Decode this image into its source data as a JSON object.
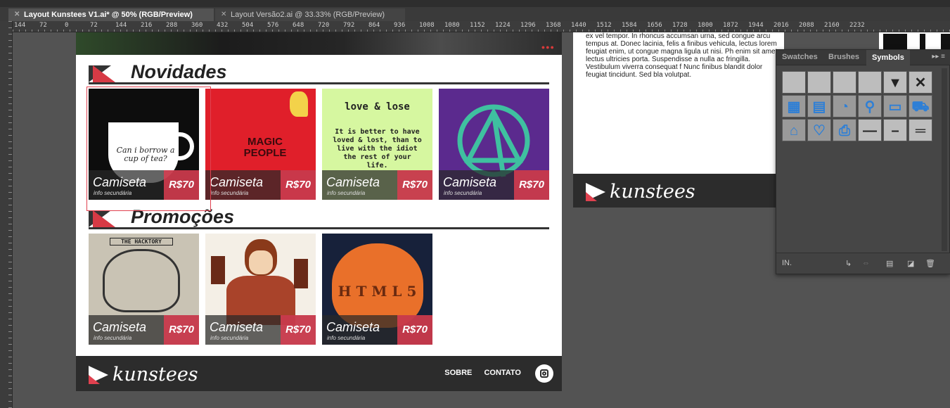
{
  "tabs": [
    {
      "label": "Layout Kunstees V1.ai* @ 50% (RGB/Preview)"
    },
    {
      "label": "Layout Versão2.ai @ 33.33% (RGB/Preview)"
    }
  ],
  "ruler": {
    "h_numbers": [
      "144",
      "72",
      "0",
      "72",
      "144",
      "216",
      "288",
      "360",
      "432",
      "504",
      "576",
      "648",
      "720",
      "792",
      "864",
      "936",
      "1008",
      "1080",
      "1152",
      "1224",
      "1296",
      "1368",
      "1440",
      "1512",
      "1584",
      "1656",
      "1728",
      "1800",
      "1872",
      "1944",
      "2016",
      "2088",
      "2160",
      "2232"
    ]
  },
  "artboard": {
    "hero_dots": "●●●",
    "sections": {
      "novidades": "Novidades",
      "promocoes": "Promoções"
    },
    "novidades_cards": [
      {
        "name": "Camiseta",
        "sub": "info secundária",
        "price": "R$70",
        "art_text": "Can i borrow a cup of tea?"
      },
      {
        "name": "Camiseta",
        "sub": "info secundária",
        "price": "R$70",
        "art_text": "MAGIC PEOPLE"
      },
      {
        "name": "Camiseta",
        "sub": "info secundária",
        "price": "R$70",
        "art_title": "love & lose",
        "art_text": "It is better to have loved & lost, than to live with the idiot the rest of your life."
      },
      {
        "name": "Camiseta",
        "sub": "info secundária",
        "price": "R$70"
      }
    ],
    "promocoes_cards": [
      {
        "name": "Camiseta",
        "sub": "info secundária",
        "price": "R$70",
        "art_text": "THE HACKTORY"
      },
      {
        "name": "Camiseta",
        "sub": "info secundária",
        "price": "R$70"
      },
      {
        "name": "Camiseta",
        "sub": "info secundária",
        "price": "R$70",
        "art_text": "H T M L 5"
      }
    ],
    "footer": {
      "logo": "kunstees",
      "links": [
        "SOBRE",
        "CONTATO"
      ]
    }
  },
  "artboard2": {
    "paragraph": "ex vel tempor. In rhoncus accumsan urna, sed congue arcu tempus at. Donec lacinia, felis a finibus vehicula, lectus lorem feugiat enim, ut congue magna ligula ut nisi. Ph enim sit amet lectus ultricies porta. Suspendisse a nulla ac fringilla. Vestibulum viverra consequat f Nunc finibus blandit dolor feugiat tincidunt. Sed bla volutpat.",
    "logo": "kunstees"
  },
  "panel": {
    "tabs": [
      "Swatches",
      "Brushes",
      "Symbols"
    ],
    "menu": "▸▸ ≡",
    "bottom_left": "IN.",
    "symbols": [
      {
        "name": "button-light-symbol",
        "glyph": ""
      },
      {
        "name": "button-light-2-symbol",
        "glyph": ""
      },
      {
        "name": "button-light-3-symbol",
        "glyph": ""
      },
      {
        "name": "field-symbol",
        "glyph": ""
      },
      {
        "name": "dropdown-symbol",
        "glyph": "▼"
      },
      {
        "name": "close-symbol",
        "glyph": "✕"
      },
      {
        "name": "calendar-icon",
        "glyph": "▦"
      },
      {
        "name": "film-icon",
        "glyph": "▤"
      },
      {
        "name": "rss-icon",
        "glyph": "◔"
      },
      {
        "name": "search-icon",
        "glyph": "⚲"
      },
      {
        "name": "card-icon",
        "glyph": "▭"
      },
      {
        "name": "cart-icon",
        "glyph": "⛟"
      },
      {
        "name": "home-icon",
        "glyph": "⌂"
      },
      {
        "name": "health-icon",
        "glyph": "♡"
      },
      {
        "name": "print-icon",
        "glyph": "⎙"
      },
      {
        "name": "line-symbol",
        "glyph": "—"
      },
      {
        "name": "slider-symbol",
        "glyph": "–"
      },
      {
        "name": "lines-symbol",
        "glyph": "═"
      }
    ]
  }
}
